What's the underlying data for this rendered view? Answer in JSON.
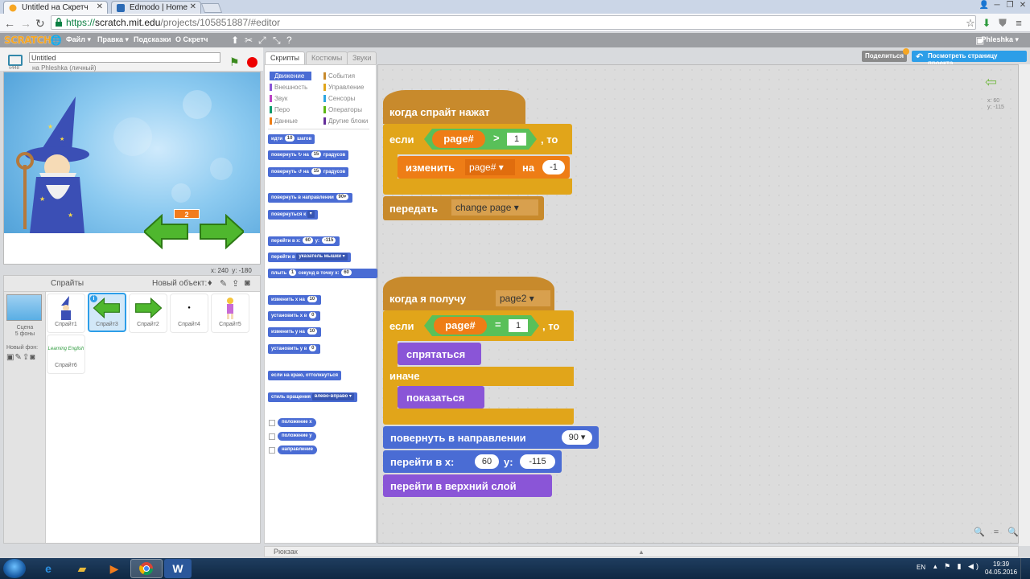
{
  "browser": {
    "tabs": [
      {
        "title": "Untitled на Скретч",
        "active": true
      },
      {
        "title": "Edmodo | Home",
        "active": false
      }
    ],
    "url_scheme": "https://",
    "url_host": "scratch.mit.edu",
    "url_path": "/projects/105851887/#editor"
  },
  "menubar": {
    "logo": "SCRATCH",
    "items": [
      "Файл ▾",
      "Правка ▾",
      "Подсказки",
      "О Скретч"
    ],
    "user": "Phleshka ▾"
  },
  "stage": {
    "project_title": "Untitled",
    "owner": "на Phleshka (личный)",
    "mode_label": "v448",
    "page_counter": "2",
    "coords_x_label": "x:",
    "coords_x": "240",
    "coords_y_label": "y:",
    "coords_y": "-180"
  },
  "sprites_panel": {
    "title": "Спрайты",
    "new_object": "Новый объект:",
    "scene_label": "Сцена",
    "scene_count": "5 фоны",
    "new_bg": "Новый фон:",
    "sprites": [
      {
        "name": "Спрайт1",
        "selected": false
      },
      {
        "name": "Спрайт3",
        "selected": true
      },
      {
        "name": "Спрайт2",
        "selected": false
      },
      {
        "name": "Спрайт4",
        "selected": false
      },
      {
        "name": "Спрайт5",
        "selected": false
      },
      {
        "name": "Спрайт6",
        "selected": false
      }
    ],
    "sprite6_text": "Learning English"
  },
  "editor_tabs": [
    "Скрипты",
    "Костюмы",
    "Звуки"
  ],
  "categories": [
    {
      "label": "Движение",
      "color": "#4a6cd4",
      "active": true
    },
    {
      "label": "События",
      "color": "#c88a2c",
      "active": false
    },
    {
      "label": "Внешность",
      "color": "#8a55d7",
      "active": false
    },
    {
      "label": "Управление",
      "color": "#e1a51a",
      "active": false
    },
    {
      "label": "Звук",
      "color": "#bb42c3",
      "active": false
    },
    {
      "label": "Сенсоры",
      "color": "#2ca5e2",
      "active": false
    },
    {
      "label": "Перо",
      "color": "#0e9a6c",
      "active": false
    },
    {
      "label": "Операторы",
      "color": "#5cb712",
      "active": false
    },
    {
      "label": "Данные",
      "color": "#ee7d16",
      "active": false
    },
    {
      "label": "Другие блоки",
      "color": "#632d99",
      "active": false
    }
  ],
  "palette": {
    "b1": {
      "pre": "идти",
      "num": "10",
      "post": "шагов"
    },
    "b2": {
      "pre": "повернуть ↻ на",
      "num": "15",
      "post": "градусов"
    },
    "b3": {
      "pre": "повернуть ↺ на",
      "num": "15",
      "post": "градусов"
    },
    "b4": {
      "pre": "повернуть в направлении",
      "num": "90▾"
    },
    "b5": {
      "pre": "повернуться к",
      "dd": "▾"
    },
    "b6": {
      "pre": "перейти в x:",
      "num": "60",
      "mid": "y:",
      "num2": "-115"
    },
    "b7": {
      "pre": "перейти в",
      "dd": "указатель мышки ▾"
    },
    "b8": {
      "pre": "плыть",
      "num": "1",
      "mid": "секунд в точку x:",
      "num2": "60"
    },
    "b9": {
      "pre": "изменить x на",
      "num": "10"
    },
    "b10": {
      "pre": "установить x в",
      "num": "0"
    },
    "b11": {
      "pre": "изменить y на",
      "num": "10"
    },
    "b12": {
      "pre": "установить y в",
      "num": "0"
    },
    "b13": {
      "pre": "если на краю, оттолкнуться"
    },
    "b14": {
      "pre": "стиль вращения",
      "dd": "влево-вправо ▾"
    },
    "r1": "положение x",
    "r2": "положение y",
    "r3": "направление"
  },
  "header_buttons": {
    "share": "Поделиться",
    "view_page": "Посмотреть страницу проекта"
  },
  "sprite_info": {
    "x_label": "x:",
    "x": "60",
    "y_label": "y:",
    "y": "-115"
  },
  "script1": {
    "hat": "когда спрайт нажат",
    "if_label": "если",
    "then_label": ", то",
    "var": "page#",
    "op": ">",
    "val": "1",
    "change_label": "изменить",
    "change_var": "page# ▾",
    "by_label": "на",
    "by_val": "-1",
    "broadcast_label": "передать",
    "broadcast_msg": "change page ▾"
  },
  "script2": {
    "hat": "когда я получу",
    "msg": "page2 ▾",
    "if_label": "если",
    "then_label": ", то",
    "var": "page#",
    "op": "=",
    "val": "1",
    "hide": "спрятаться",
    "else_label": "иначе",
    "show": "показаться",
    "point_label": "повернуть в направлении",
    "point_val": "90 ▾",
    "goto_label": "перейти в x:",
    "goto_x": "60",
    "goto_y_label": "y:",
    "goto_y": "-115",
    "front": "перейти в верхний слой"
  },
  "zoom": "🔍 = 🔍",
  "backpack": "Рюкзак",
  "taskbar": {
    "lang": "EN",
    "time": "19:39",
    "date": "04.05.2016"
  }
}
